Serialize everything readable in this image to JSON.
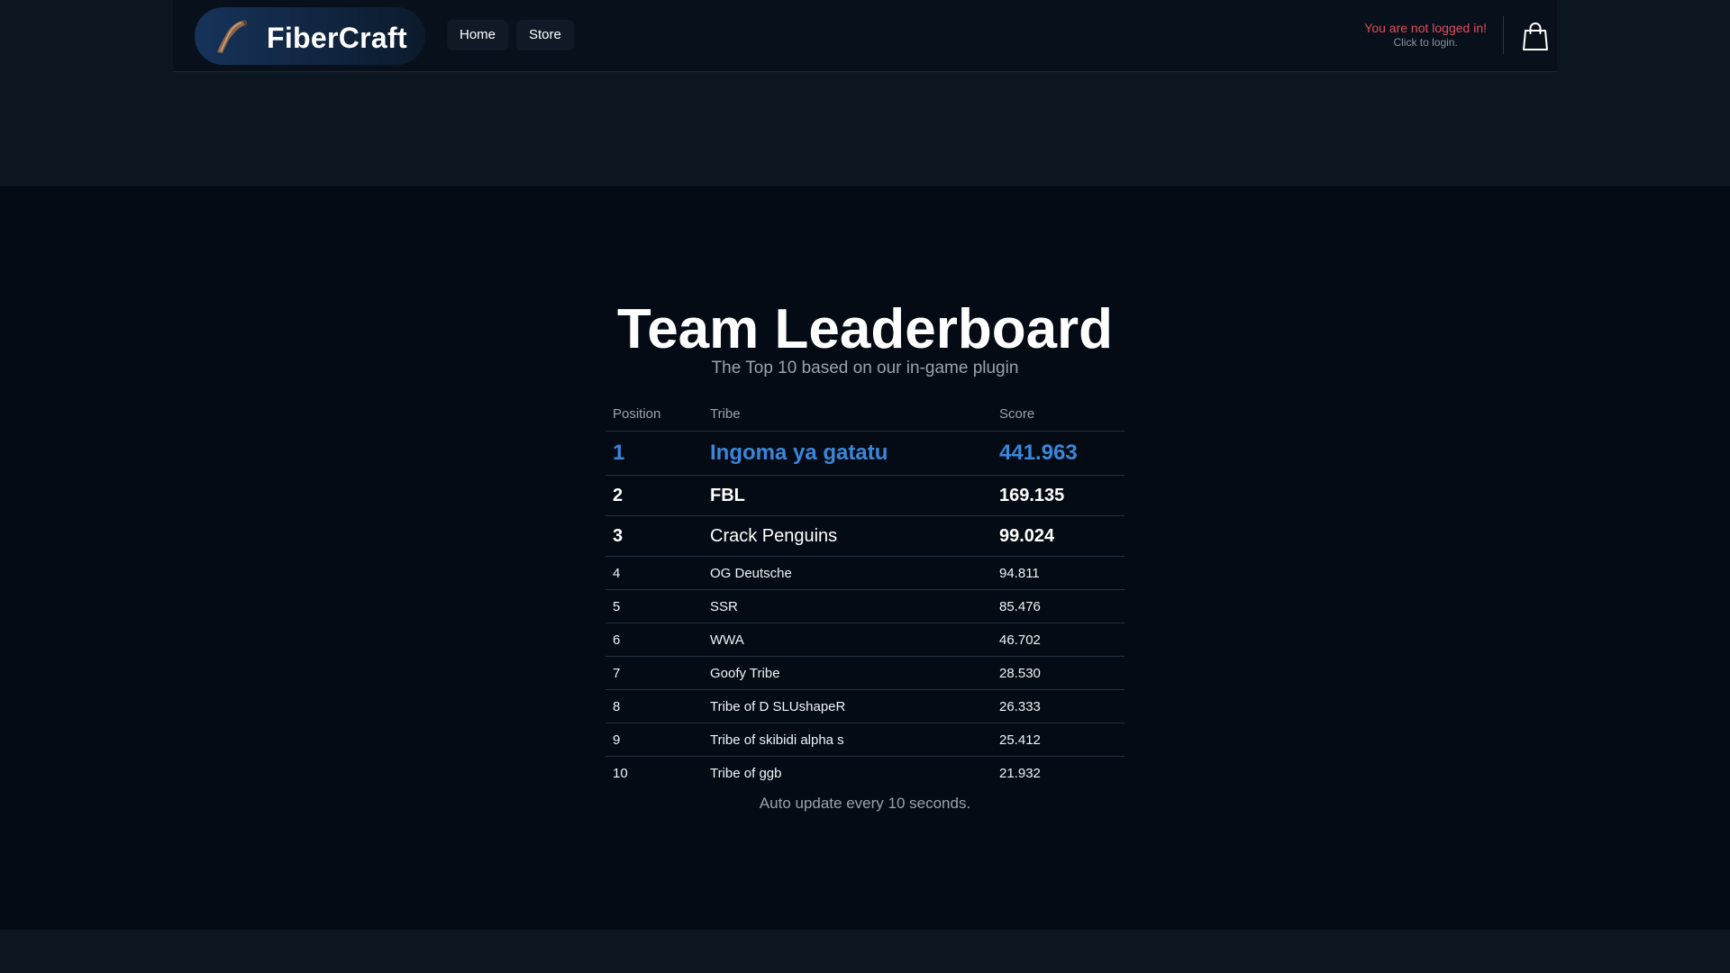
{
  "brand": {
    "name": "FiberCraft",
    "logo_icon": "fiber-logo-icon"
  },
  "nav": {
    "items": [
      {
        "label": "Home"
      },
      {
        "label": "Store"
      }
    ]
  },
  "account": {
    "status": "You are not logged in!",
    "hint": "Click to login.",
    "status_color": "#e34b58"
  },
  "cart": {
    "icon": "shopping-bag-icon"
  },
  "leaderboard": {
    "title": "Team Leaderboard",
    "subtitle": "The Top 10 based on our in-game plugin",
    "columns": [
      "Position",
      "Tribe",
      "Score"
    ],
    "rows": [
      {
        "position": "1",
        "tribe": "Ingoma ya gatatu",
        "score": "441.963"
      },
      {
        "position": "2",
        "tribe": "FBL",
        "score": "169.135"
      },
      {
        "position": "3",
        "tribe": "Crack Penguins",
        "score": "99.024"
      },
      {
        "position": "4",
        "tribe": "OG Deutsche",
        "score": "94.811"
      },
      {
        "position": "5",
        "tribe": "SSR",
        "score": "85.476"
      },
      {
        "position": "6",
        "tribe": "WWA",
        "score": "46.702"
      },
      {
        "position": "7",
        "tribe": "Goofy Tribe",
        "score": "28.530"
      },
      {
        "position": "8",
        "tribe": "Tribe of D SLUshapeR",
        "score": "26.333"
      },
      {
        "position": "9",
        "tribe": "Tribe of skibidi alpha s",
        "score": "25.412"
      },
      {
        "position": "10",
        "tribe": "Tribe of ggb",
        "score": "21.932"
      }
    ],
    "footer": "Auto update every 10 seconds.",
    "first_place_color": "#3b86d9"
  }
}
